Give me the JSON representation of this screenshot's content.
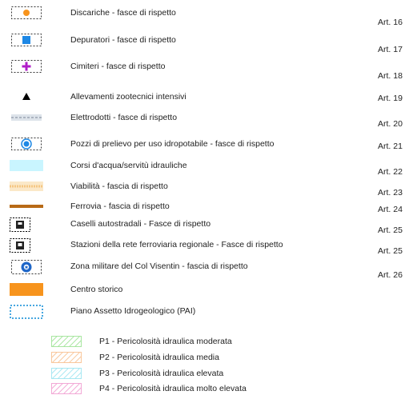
{
  "colors": {
    "orange": "#f7941d",
    "blue": "#1e88e5",
    "purple": "#b01ec8",
    "cyan": "#c9f5ff",
    "road": "#f5c682",
    "rail": "#b86a16",
    "pai": "#46a7e0",
    "p1": "#a8e6a0",
    "p2": "#f9c79c",
    "p3": "#a7e7f2",
    "p4": "#f2a9d6"
  },
  "legend": {
    "items": [
      {
        "icon": "circle-orange-icon",
        "label": "Discariche -  fasce di rispetto",
        "article": "Art. 16"
      },
      {
        "icon": "square-blue-icon",
        "label": "Depuratori - fasce di rispetto",
        "article": "Art. 17"
      },
      {
        "icon": "cross-purple-icon",
        "label": "Cimiteri - fasce di rispetto",
        "article": "Art. 18"
      },
      {
        "icon": "triangle-black-icon",
        "label": "Allevamenti zootecnici intensivi",
        "article": "Art. 19"
      },
      {
        "icon": "power-line-icon",
        "label": "Elettrodotti - fasce di rispetto",
        "article": "Art. 20"
      },
      {
        "icon": "well-icon",
        "label": "Pozzi di prelievo per uso idropotabile - fasce di rispetto",
        "article": "Art. 21"
      },
      {
        "icon": "watercourse-icon",
        "label": "Corsi d'acqua/servitù idrauliche",
        "article": "Art. 22"
      },
      {
        "icon": "road-icon",
        "label": "Viabilità - fascia di rispetto",
        "article": "Art. 23"
      },
      {
        "icon": "railway-icon",
        "label": "Ferrovia - fascia di rispetto",
        "article": "Art. 24"
      },
      {
        "icon": "toll-booth-icon",
        "label": "Caselli autostradali - Fasce di rispetto",
        "article": "Art. 25"
      },
      {
        "icon": "train-station-icon",
        "label": "Stazioni della rete ferroviaria regionale - Fasce di rispetto",
        "article": "Art. 25"
      },
      {
        "icon": "military-zone-icon",
        "label": "Zona militare del Col Visentin - fascia di rispetto",
        "article": "Art. 26"
      },
      {
        "icon": "historic-center-icon",
        "label": "Centro storico",
        "article": ""
      },
      {
        "icon": "pai-boundary-icon",
        "label": "Piano Assetto Idrogeologico (PAI)",
        "article": ""
      }
    ],
    "hazard": [
      {
        "icon": "hatch-green-icon",
        "label": "P1 - Pericolosità idraulica moderata"
      },
      {
        "icon": "hatch-orange-icon",
        "label": "P2 - Pericolosità idraulica media"
      },
      {
        "icon": "hatch-cyan-icon",
        "label": "P3 - Pericolosità idraulica elevata"
      },
      {
        "icon": "hatch-pink-icon",
        "label": "P4 - Pericolosità idraulica molto elevata"
      }
    ]
  }
}
